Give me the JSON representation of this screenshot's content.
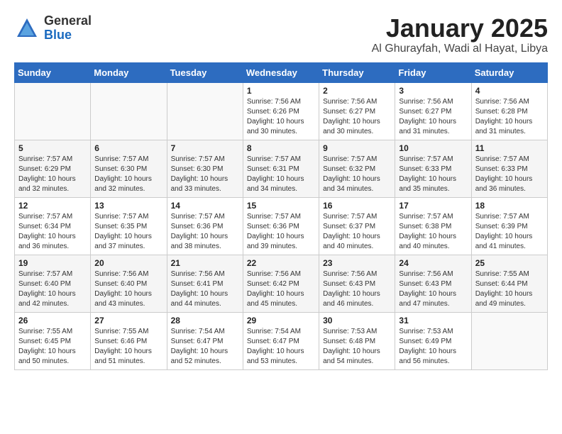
{
  "logo": {
    "general": "General",
    "blue": "Blue"
  },
  "title": "January 2025",
  "subtitle": "Al Ghurayfah, Wadi al Hayat, Libya",
  "days_of_week": [
    "Sunday",
    "Monday",
    "Tuesday",
    "Wednesday",
    "Thursday",
    "Friday",
    "Saturday"
  ],
  "weeks": [
    [
      {
        "num": "",
        "sunrise": "",
        "sunset": "",
        "daylight": ""
      },
      {
        "num": "",
        "sunrise": "",
        "sunset": "",
        "daylight": ""
      },
      {
        "num": "",
        "sunrise": "",
        "sunset": "",
        "daylight": ""
      },
      {
        "num": "1",
        "sunrise": "Sunrise: 7:56 AM",
        "sunset": "Sunset: 6:26 PM",
        "daylight": "Daylight: 10 hours and 30 minutes."
      },
      {
        "num": "2",
        "sunrise": "Sunrise: 7:56 AM",
        "sunset": "Sunset: 6:27 PM",
        "daylight": "Daylight: 10 hours and 30 minutes."
      },
      {
        "num": "3",
        "sunrise": "Sunrise: 7:56 AM",
        "sunset": "Sunset: 6:27 PM",
        "daylight": "Daylight: 10 hours and 31 minutes."
      },
      {
        "num": "4",
        "sunrise": "Sunrise: 7:56 AM",
        "sunset": "Sunset: 6:28 PM",
        "daylight": "Daylight: 10 hours and 31 minutes."
      }
    ],
    [
      {
        "num": "5",
        "sunrise": "Sunrise: 7:57 AM",
        "sunset": "Sunset: 6:29 PM",
        "daylight": "Daylight: 10 hours and 32 minutes."
      },
      {
        "num": "6",
        "sunrise": "Sunrise: 7:57 AM",
        "sunset": "Sunset: 6:30 PM",
        "daylight": "Daylight: 10 hours and 32 minutes."
      },
      {
        "num": "7",
        "sunrise": "Sunrise: 7:57 AM",
        "sunset": "Sunset: 6:30 PM",
        "daylight": "Daylight: 10 hours and 33 minutes."
      },
      {
        "num": "8",
        "sunrise": "Sunrise: 7:57 AM",
        "sunset": "Sunset: 6:31 PM",
        "daylight": "Daylight: 10 hours and 34 minutes."
      },
      {
        "num": "9",
        "sunrise": "Sunrise: 7:57 AM",
        "sunset": "Sunset: 6:32 PM",
        "daylight": "Daylight: 10 hours and 34 minutes."
      },
      {
        "num": "10",
        "sunrise": "Sunrise: 7:57 AM",
        "sunset": "Sunset: 6:33 PM",
        "daylight": "Daylight: 10 hours and 35 minutes."
      },
      {
        "num": "11",
        "sunrise": "Sunrise: 7:57 AM",
        "sunset": "Sunset: 6:33 PM",
        "daylight": "Daylight: 10 hours and 36 minutes."
      }
    ],
    [
      {
        "num": "12",
        "sunrise": "Sunrise: 7:57 AM",
        "sunset": "Sunset: 6:34 PM",
        "daylight": "Daylight: 10 hours and 36 minutes."
      },
      {
        "num": "13",
        "sunrise": "Sunrise: 7:57 AM",
        "sunset": "Sunset: 6:35 PM",
        "daylight": "Daylight: 10 hours and 37 minutes."
      },
      {
        "num": "14",
        "sunrise": "Sunrise: 7:57 AM",
        "sunset": "Sunset: 6:36 PM",
        "daylight": "Daylight: 10 hours and 38 minutes."
      },
      {
        "num": "15",
        "sunrise": "Sunrise: 7:57 AM",
        "sunset": "Sunset: 6:36 PM",
        "daylight": "Daylight: 10 hours and 39 minutes."
      },
      {
        "num": "16",
        "sunrise": "Sunrise: 7:57 AM",
        "sunset": "Sunset: 6:37 PM",
        "daylight": "Daylight: 10 hours and 40 minutes."
      },
      {
        "num": "17",
        "sunrise": "Sunrise: 7:57 AM",
        "sunset": "Sunset: 6:38 PM",
        "daylight": "Daylight: 10 hours and 40 minutes."
      },
      {
        "num": "18",
        "sunrise": "Sunrise: 7:57 AM",
        "sunset": "Sunset: 6:39 PM",
        "daylight": "Daylight: 10 hours and 41 minutes."
      }
    ],
    [
      {
        "num": "19",
        "sunrise": "Sunrise: 7:57 AM",
        "sunset": "Sunset: 6:40 PM",
        "daylight": "Daylight: 10 hours and 42 minutes."
      },
      {
        "num": "20",
        "sunrise": "Sunrise: 7:56 AM",
        "sunset": "Sunset: 6:40 PM",
        "daylight": "Daylight: 10 hours and 43 minutes."
      },
      {
        "num": "21",
        "sunrise": "Sunrise: 7:56 AM",
        "sunset": "Sunset: 6:41 PM",
        "daylight": "Daylight: 10 hours and 44 minutes."
      },
      {
        "num": "22",
        "sunrise": "Sunrise: 7:56 AM",
        "sunset": "Sunset: 6:42 PM",
        "daylight": "Daylight: 10 hours and 45 minutes."
      },
      {
        "num": "23",
        "sunrise": "Sunrise: 7:56 AM",
        "sunset": "Sunset: 6:43 PM",
        "daylight": "Daylight: 10 hours and 46 minutes."
      },
      {
        "num": "24",
        "sunrise": "Sunrise: 7:56 AM",
        "sunset": "Sunset: 6:43 PM",
        "daylight": "Daylight: 10 hours and 47 minutes."
      },
      {
        "num": "25",
        "sunrise": "Sunrise: 7:55 AM",
        "sunset": "Sunset: 6:44 PM",
        "daylight": "Daylight: 10 hours and 49 minutes."
      }
    ],
    [
      {
        "num": "26",
        "sunrise": "Sunrise: 7:55 AM",
        "sunset": "Sunset: 6:45 PM",
        "daylight": "Daylight: 10 hours and 50 minutes."
      },
      {
        "num": "27",
        "sunrise": "Sunrise: 7:55 AM",
        "sunset": "Sunset: 6:46 PM",
        "daylight": "Daylight: 10 hours and 51 minutes."
      },
      {
        "num": "28",
        "sunrise": "Sunrise: 7:54 AM",
        "sunset": "Sunset: 6:47 PM",
        "daylight": "Daylight: 10 hours and 52 minutes."
      },
      {
        "num": "29",
        "sunrise": "Sunrise: 7:54 AM",
        "sunset": "Sunset: 6:47 PM",
        "daylight": "Daylight: 10 hours and 53 minutes."
      },
      {
        "num": "30",
        "sunrise": "Sunrise: 7:53 AM",
        "sunset": "Sunset: 6:48 PM",
        "daylight": "Daylight: 10 hours and 54 minutes."
      },
      {
        "num": "31",
        "sunrise": "Sunrise: 7:53 AM",
        "sunset": "Sunset: 6:49 PM",
        "daylight": "Daylight: 10 hours and 56 minutes."
      },
      {
        "num": "",
        "sunrise": "",
        "sunset": "",
        "daylight": ""
      }
    ]
  ]
}
